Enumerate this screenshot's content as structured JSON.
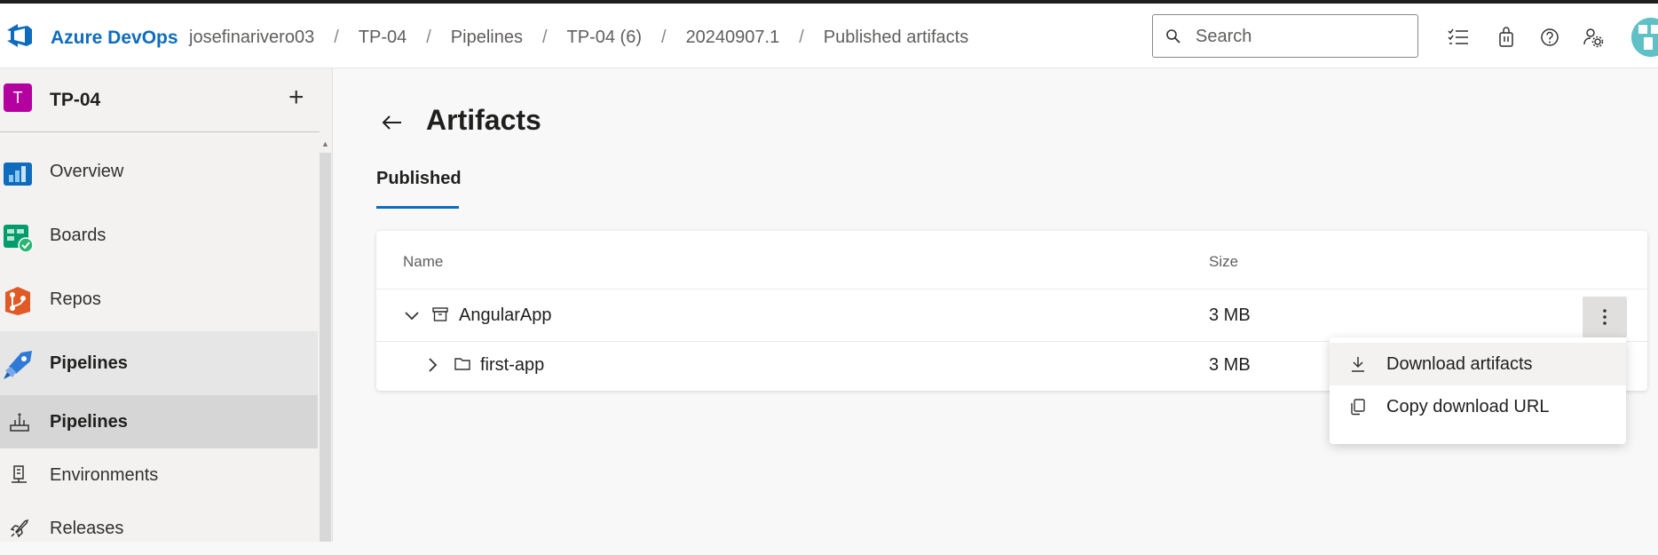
{
  "header": {
    "brand": "Azure DevOps",
    "breadcrumbs": [
      "josefinarivero03",
      "TP-04",
      "Pipelines",
      "TP-04 (6)",
      "20240907.1",
      "Published artifacts"
    ],
    "separator": "/",
    "search_placeholder": "Search",
    "icons": [
      "checklist-icon",
      "shopping-bag-icon",
      "help-icon",
      "user-settings-icon"
    ]
  },
  "sidebar": {
    "project_initial": "T",
    "project_name": "TP-04",
    "add_label": "+",
    "items": [
      {
        "label": "Overview",
        "icon": "overview-icon"
      },
      {
        "label": "Boards",
        "icon": "boards-icon"
      },
      {
        "label": "Repos",
        "icon": "repos-icon"
      },
      {
        "label": "Pipelines",
        "icon": "pipelines-icon"
      }
    ],
    "subitems": [
      {
        "label": "Pipelines",
        "icon": "pipelines-sub-icon"
      },
      {
        "label": "Environments",
        "icon": "environments-icon"
      },
      {
        "label": "Releases",
        "icon": "releases-icon"
      }
    ]
  },
  "main": {
    "title": "Artifacts",
    "tab": "Published",
    "table": {
      "columns": [
        "Name",
        "Size"
      ],
      "rows": [
        {
          "name": "AngularApp",
          "size": "3 MB",
          "expanded": true,
          "icon": "artifact-box-icon"
        },
        {
          "name": "first-app",
          "size": "3 MB",
          "expanded": false,
          "icon": "folder-icon"
        }
      ]
    },
    "context_menu": {
      "items": [
        {
          "label": "Download artifacts",
          "icon": "download-icon"
        },
        {
          "label": "Copy download URL",
          "icon": "copy-icon"
        }
      ]
    }
  },
  "colors": {
    "accent": "#0f6cbd",
    "project_badge": "#b4009e"
  }
}
